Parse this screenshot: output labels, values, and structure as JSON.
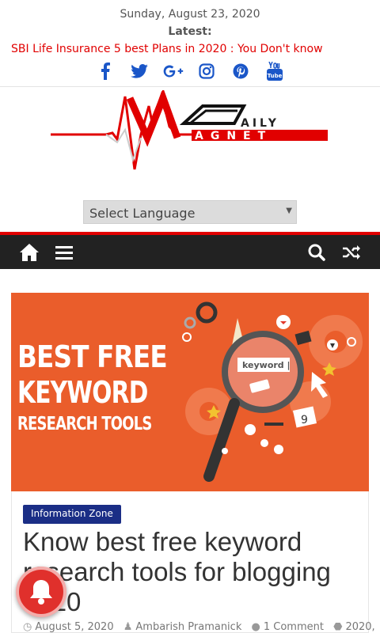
{
  "header": {
    "date": "Sunday, August 23, 2020",
    "latest_label": "Latest:",
    "ticker_text": "SBI Life Insurance 5 best Plans in 2020 : You Don't know"
  },
  "socials": [
    {
      "icon": "facebook-icon"
    },
    {
      "icon": "twitter-icon"
    },
    {
      "icon": "google-plus-icon"
    },
    {
      "icon": "instagram-icon"
    },
    {
      "icon": "pinterest-icon"
    },
    {
      "icon": "youtube-icon"
    }
  ],
  "logo": {
    "line1": "AILY",
    "line2": "AGNET"
  },
  "language": {
    "selected": "Select Language"
  },
  "nav": {
    "home_icon": "home-icon",
    "menu_icon": "menu-icon",
    "search_icon": "search-icon",
    "random_icon": "shuffle-icon"
  },
  "hero": {
    "line1": "BEST FREE",
    "line2": "KEYWORD",
    "line3": "RESEARCH TOOLS",
    "search_text": "keyword |",
    "badge_number": "9"
  },
  "post": {
    "category": "Information Zone",
    "title": "Know best free keyword research tools for blogging 2020",
    "date": "August 5, 2020",
    "author": "Ambarish Pramanick",
    "comments": "1 Comment",
    "tag": "2020,"
  },
  "colors": {
    "accent": "#e10000",
    "nav_bg": "#222222",
    "hero_bg": "#ea5d2b",
    "category_bg": "#1b2e86",
    "social": "#1a56c8"
  }
}
